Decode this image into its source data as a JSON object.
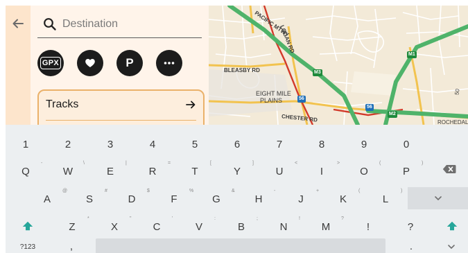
{
  "colors": {
    "panel_bg": "#fff4ea",
    "back_strip_bg": "#fde5cc",
    "card_border": "#eab16a",
    "button_dark": "#1c1c1c",
    "map_bg": "#f3ead8",
    "motorway_green": "#4fb36a",
    "arterial_red": "#d23a2a",
    "keyboard_bg": "#eceff1",
    "keyboard_accent": "#26a69a"
  },
  "icons": {
    "back": "arrow-left-icon",
    "search": "search-icon",
    "gpx": "gpx-icon",
    "favorite": "heart-icon",
    "parking": "parking-icon",
    "more": "more-horizontal-icon",
    "tracks_arrow": "arrow-right-icon",
    "shift": "shift-icon",
    "backspace": "backspace-icon",
    "hide_keyboard": "chevron-down-icon"
  },
  "search": {
    "placeholder": "Destination",
    "value": ""
  },
  "quick_actions": {
    "gpx_label": "GPX",
    "parking_label": "P"
  },
  "tracks": {
    "label": "Tracks"
  },
  "map": {
    "labels": {
      "pacific_mtwy": "PACIFIC MTWY",
      "logan_rd": "LOGAN RD",
      "bleasby_rd": "BLEASBY RD",
      "suburb_line1": "EIGHT MILE",
      "suburb_line2": "PLAINS",
      "chester_rd": "CHESTER RD",
      "rochedale": "ROCHEDAL",
      "num_50": "50"
    },
    "shields": {
      "m1": "M1",
      "m3": "M3",
      "m2": "M2",
      "s56a": "56",
      "s56b": "56"
    }
  },
  "keyboard": {
    "numbers": [
      "1",
      "2",
      "3",
      "4",
      "5",
      "6",
      "7",
      "8",
      "9",
      "0"
    ],
    "row1": [
      "Q",
      "W",
      "E",
      "R",
      "T",
      "Y",
      "U",
      "I",
      "O",
      "P"
    ],
    "row1_hints": [
      "-",
      "\\",
      "|",
      "=",
      "[",
      "]",
      "<",
      ">",
      "(",
      ")"
    ],
    "row2": [
      "A",
      "S",
      "D",
      "F",
      "G",
      "H",
      "J",
      "K",
      "L"
    ],
    "row2_hints": [
      "@",
      "#",
      "$",
      "%",
      "&",
      "-",
      "+",
      "(",
      ")"
    ],
    "row3": [
      "Z",
      "X",
      "C",
      "V",
      "B",
      "N",
      "M",
      "!",
      "?"
    ],
    "row3_hints": [
      "*",
      "\"",
      "'",
      ":",
      ";",
      "!",
      "?"
    ],
    "symbols_label": "?123",
    "comma_label": ",",
    "period_label": "."
  }
}
